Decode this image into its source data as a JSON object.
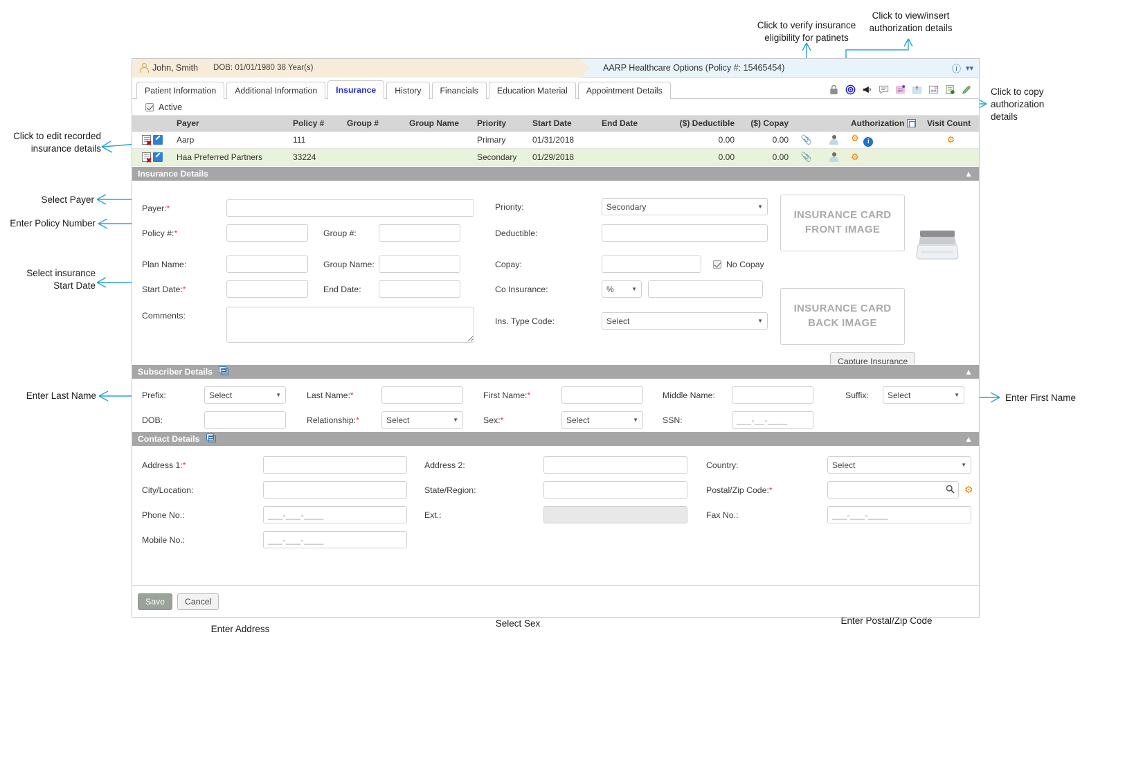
{
  "patient_bar": {
    "name": "John, Smith",
    "dob": "DOB: 01/01/1980 38 Year(s)",
    "policy": "AARP Healthcare Options (Policy #: 15465454)",
    "info_icon": "info-circle-icon",
    "collapse_icon": "double-chevron-down-icon"
  },
  "tabs": [
    {
      "label": "Patient Information",
      "active": false
    },
    {
      "label": "Additional Information",
      "active": false
    },
    {
      "label": "Insurance",
      "active": true
    },
    {
      "label": "History",
      "active": false
    },
    {
      "label": "Financials",
      "active": false
    },
    {
      "label": "Education Material",
      "active": false
    },
    {
      "label": "Appointment Details",
      "active": false
    }
  ],
  "toolbar_icons": [
    "lock-icon",
    "target-icon",
    "megaphone-icon",
    "chat-bubble-icon",
    "note-icon",
    "pin-note-icon",
    "image-icon",
    "document-scan-icon",
    "pen-icon"
  ],
  "active_filter": {
    "label": "Active",
    "checked": true
  },
  "grid": {
    "columns": [
      "Payer",
      "Policy #",
      "Group #",
      "Group Name",
      "Priority",
      "Start Date",
      "End Date",
      "($) Deductible",
      "($) Copay",
      "",
      "",
      "Authorization",
      "Visit Count"
    ],
    "rows": [
      {
        "payer": "Aarp",
        "policy": "111",
        "group": "",
        "group_name": "",
        "priority": "Primary",
        "start_date": "01/31/2018",
        "end_date": "",
        "deductible": "0.00",
        "copay": "0.00",
        "has_eligibility": true,
        "has_auth_gear": true,
        "has_auth_info": true,
        "has_visit_gear": true
      },
      {
        "payer": "Haa Preferred Partners",
        "policy": "33224",
        "group": "",
        "group_name": "",
        "priority": "Secondary",
        "start_date": "01/29/2018",
        "end_date": "",
        "deductible": "0.00",
        "copay": "0.00",
        "has_eligibility": true,
        "has_auth_gear": true,
        "has_auth_info": false,
        "has_visit_gear": false
      }
    ]
  },
  "insurance_details": {
    "title": "Insurance Details",
    "payer_label": "Payer:",
    "policy_label": "Policy #:",
    "group_label": "Group #:",
    "plan_name_label": "Plan Name:",
    "group_name_label": "Group Name:",
    "start_date_label": "Start Date:",
    "end_date_label": "End Date:",
    "comments_label": "Comments:",
    "priority_label": "Priority:",
    "priority_value": "Secondary",
    "deductible_label": "Deductible:",
    "copay_label": "Copay:",
    "no_copay_label": "No Copay",
    "no_copay_checked": true,
    "co_insurance_label": "Co Insurance:",
    "co_insurance_unit": "%",
    "ins_type_label": "Ins. Type Code:",
    "ins_type_value": "Select",
    "card_front": "INSURANCE CARD\nFRONT IMAGE",
    "card_back": "INSURANCE CARD\nBACK IMAGE",
    "capture_button": "Capture Insurance",
    "payer_value": "",
    "policy_value": "",
    "group_value": "",
    "plan_name_value": "",
    "group_name_value": "",
    "start_date_value": "",
    "end_date_value": "",
    "comments_value": "",
    "deductible_value": "",
    "copay_value": "",
    "co_insurance_value": ""
  },
  "subscriber_details": {
    "title": "Subscriber Details",
    "prefix_label": "Prefix:",
    "prefix_value": "Select",
    "last_name_label": "Last Name:",
    "last_name_value": "",
    "first_name_label": "First Name:",
    "first_name_value": "",
    "middle_name_label": "Middle Name:",
    "middle_name_value": "",
    "suffix_label": "Suffix:",
    "suffix_value": "Select",
    "dob_label": "DOB:",
    "dob_value": "",
    "relationship_label": "Relationship:",
    "relationship_value": "Select",
    "sex_label": "Sex:",
    "sex_value": "Select",
    "ssn_label": "SSN:",
    "ssn_mask": "___-__-____"
  },
  "contact_details": {
    "title": "Contact Details",
    "address1_label": "Address 1:",
    "address1_value": "",
    "address2_label": "Address 2:",
    "address2_value": "",
    "country_label": "Country:",
    "country_value": "Select",
    "city_label": "City/Location:",
    "city_value": "",
    "state_label": "State/Region:",
    "state_value": "",
    "postal_label": "Postal/Zip Code:",
    "postal_value": "",
    "phone_label": "Phone No.:",
    "phone_mask": "___-___-____",
    "ext_label": "Ext.:",
    "ext_value": "",
    "fax_label": "Fax No.:",
    "fax_mask": "___-___-____",
    "mobile_label": "Mobile No.:",
    "mobile_mask": "___-___-____"
  },
  "footer": {
    "save": "Save",
    "cancel": "Cancel"
  },
  "annotations": [
    {
      "id": "a_edit",
      "text": "Click to edit recorded\ninsurance details"
    },
    {
      "id": "a_payer",
      "text": "Select Payer"
    },
    {
      "id": "a_policy",
      "text": "Enter Policy Number"
    },
    {
      "id": "a_startdate",
      "text": "Select insurance\nStart Date"
    },
    {
      "id": "a_lastname",
      "text": "Enter Last Name"
    },
    {
      "id": "a_verify",
      "text": "Click to verify insurance\neligibility for patinets"
    },
    {
      "id": "a_auth",
      "text": "Click to view/insert\nauthorization details"
    },
    {
      "id": "a_copyauth",
      "text": "Click to copy\nauthorization\ndetails"
    },
    {
      "id": "a_firstname",
      "text": "Enter First Name"
    },
    {
      "id": "a_address",
      "text": "Enter Address"
    },
    {
      "id": "a_sex",
      "text": "Select Sex"
    },
    {
      "id": "a_postal",
      "text": "Enter Postal/Zip Code"
    }
  ],
  "colors": {
    "annotation_line": "#29a3d4",
    "accent_tab": "#2a2ad6",
    "section_bar": "#a6a6a6",
    "gear_orange": "#e8820c",
    "row_highlight": "#e9f2da",
    "patient_bar": "#f7ecd9"
  }
}
